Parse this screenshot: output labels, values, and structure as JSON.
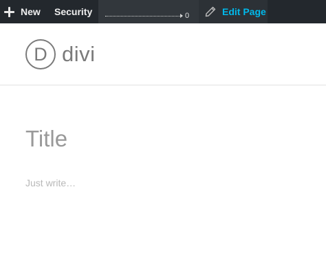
{
  "adminbar": {
    "new_label": "New",
    "security_label": "Security",
    "perf_count": "0",
    "edit_label": "Edit Page",
    "icons": {
      "new": "plus-icon",
      "edit": "pencil-icon",
      "meter": "arrow-right-icon"
    },
    "colors": {
      "bar": "#23282d",
      "edit_link": "#00b9eb"
    }
  },
  "header": {
    "logo_mark": "D",
    "logo_word": "divi"
  },
  "content": {
    "title_placeholder": "Title",
    "body_placeholder": "Just write…"
  }
}
